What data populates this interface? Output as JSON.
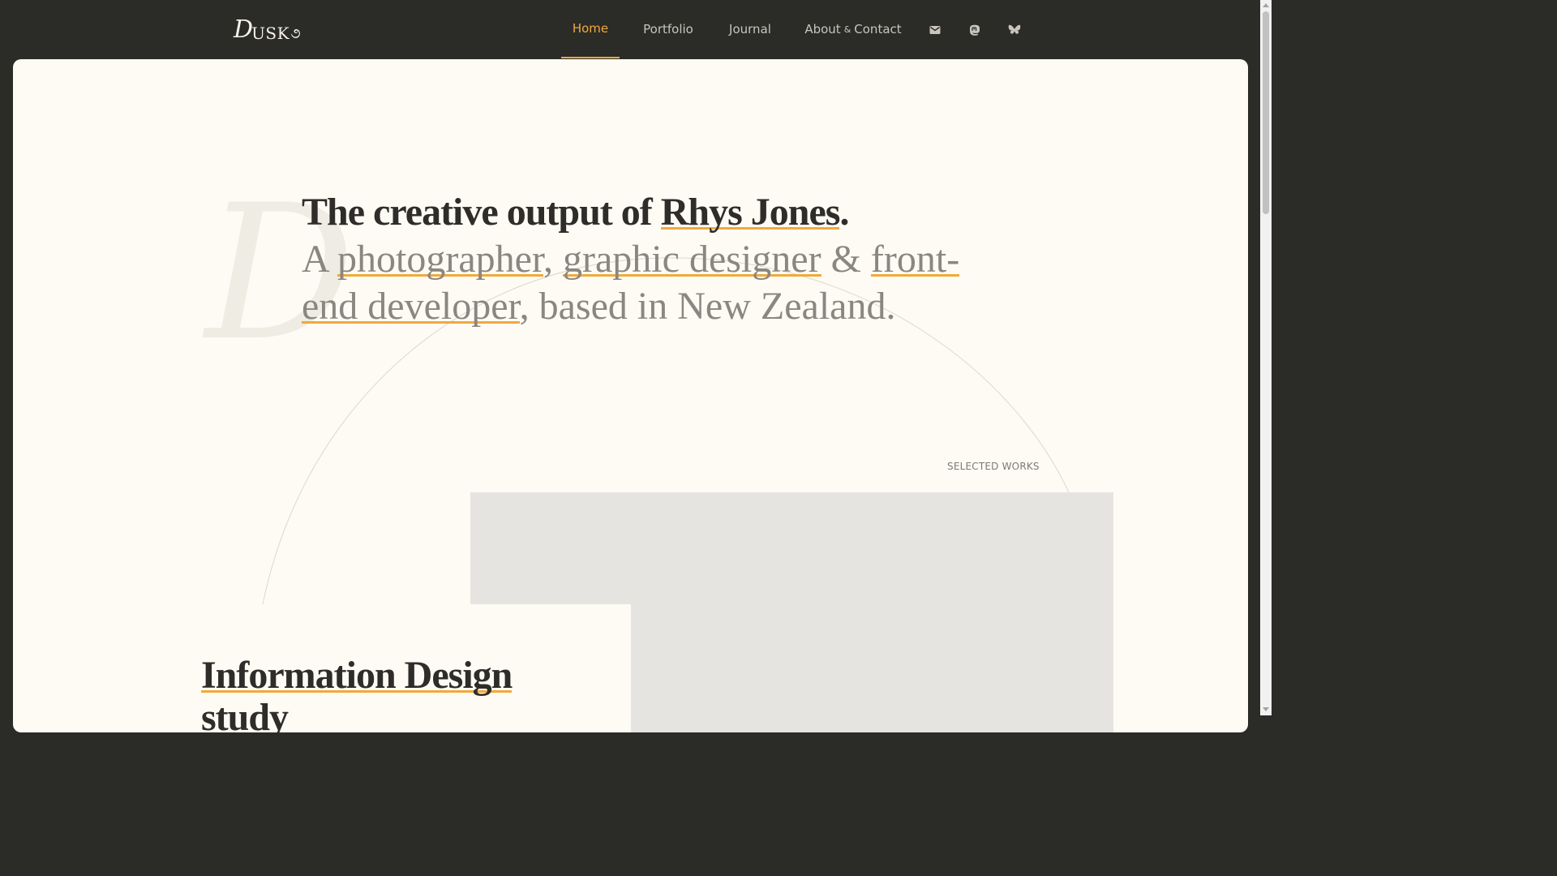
{
  "brand": {
    "logo_d": "D",
    "logo_rest": "USK",
    "logo_swash": "૭"
  },
  "nav": {
    "items": [
      {
        "label": "Home",
        "active": true
      },
      {
        "label": "Portfolio",
        "active": false
      },
      {
        "label": "Journal",
        "active": false
      }
    ],
    "about": {
      "label_a": "About",
      "amp": "&",
      "label_b": "Contact"
    },
    "icons": [
      "mail-icon",
      "mastodon-icon",
      "bluesky-icon"
    ]
  },
  "hero": {
    "line1_prefix": "The creative output of ",
    "name": "Rhys Jones",
    "line1_suffix": ".",
    "intro_a": "A ",
    "role1": "photographer",
    "sep1": ", ",
    "role2": "graphic designer",
    "sep2": " & ",
    "role3": "front-end developer",
    "outro": ", based in New Zealand."
  },
  "decor": {
    "big_letter": "D"
  },
  "works": {
    "heading": "SELECTED WORKS",
    "first_title": "Information Design study"
  },
  "colors": {
    "accent": "#f2a93b",
    "background_dark": "#2b2b28",
    "card": "#fdfbf4",
    "text_dark": "#2e2d2a",
    "text_muted": "#8a8780"
  }
}
